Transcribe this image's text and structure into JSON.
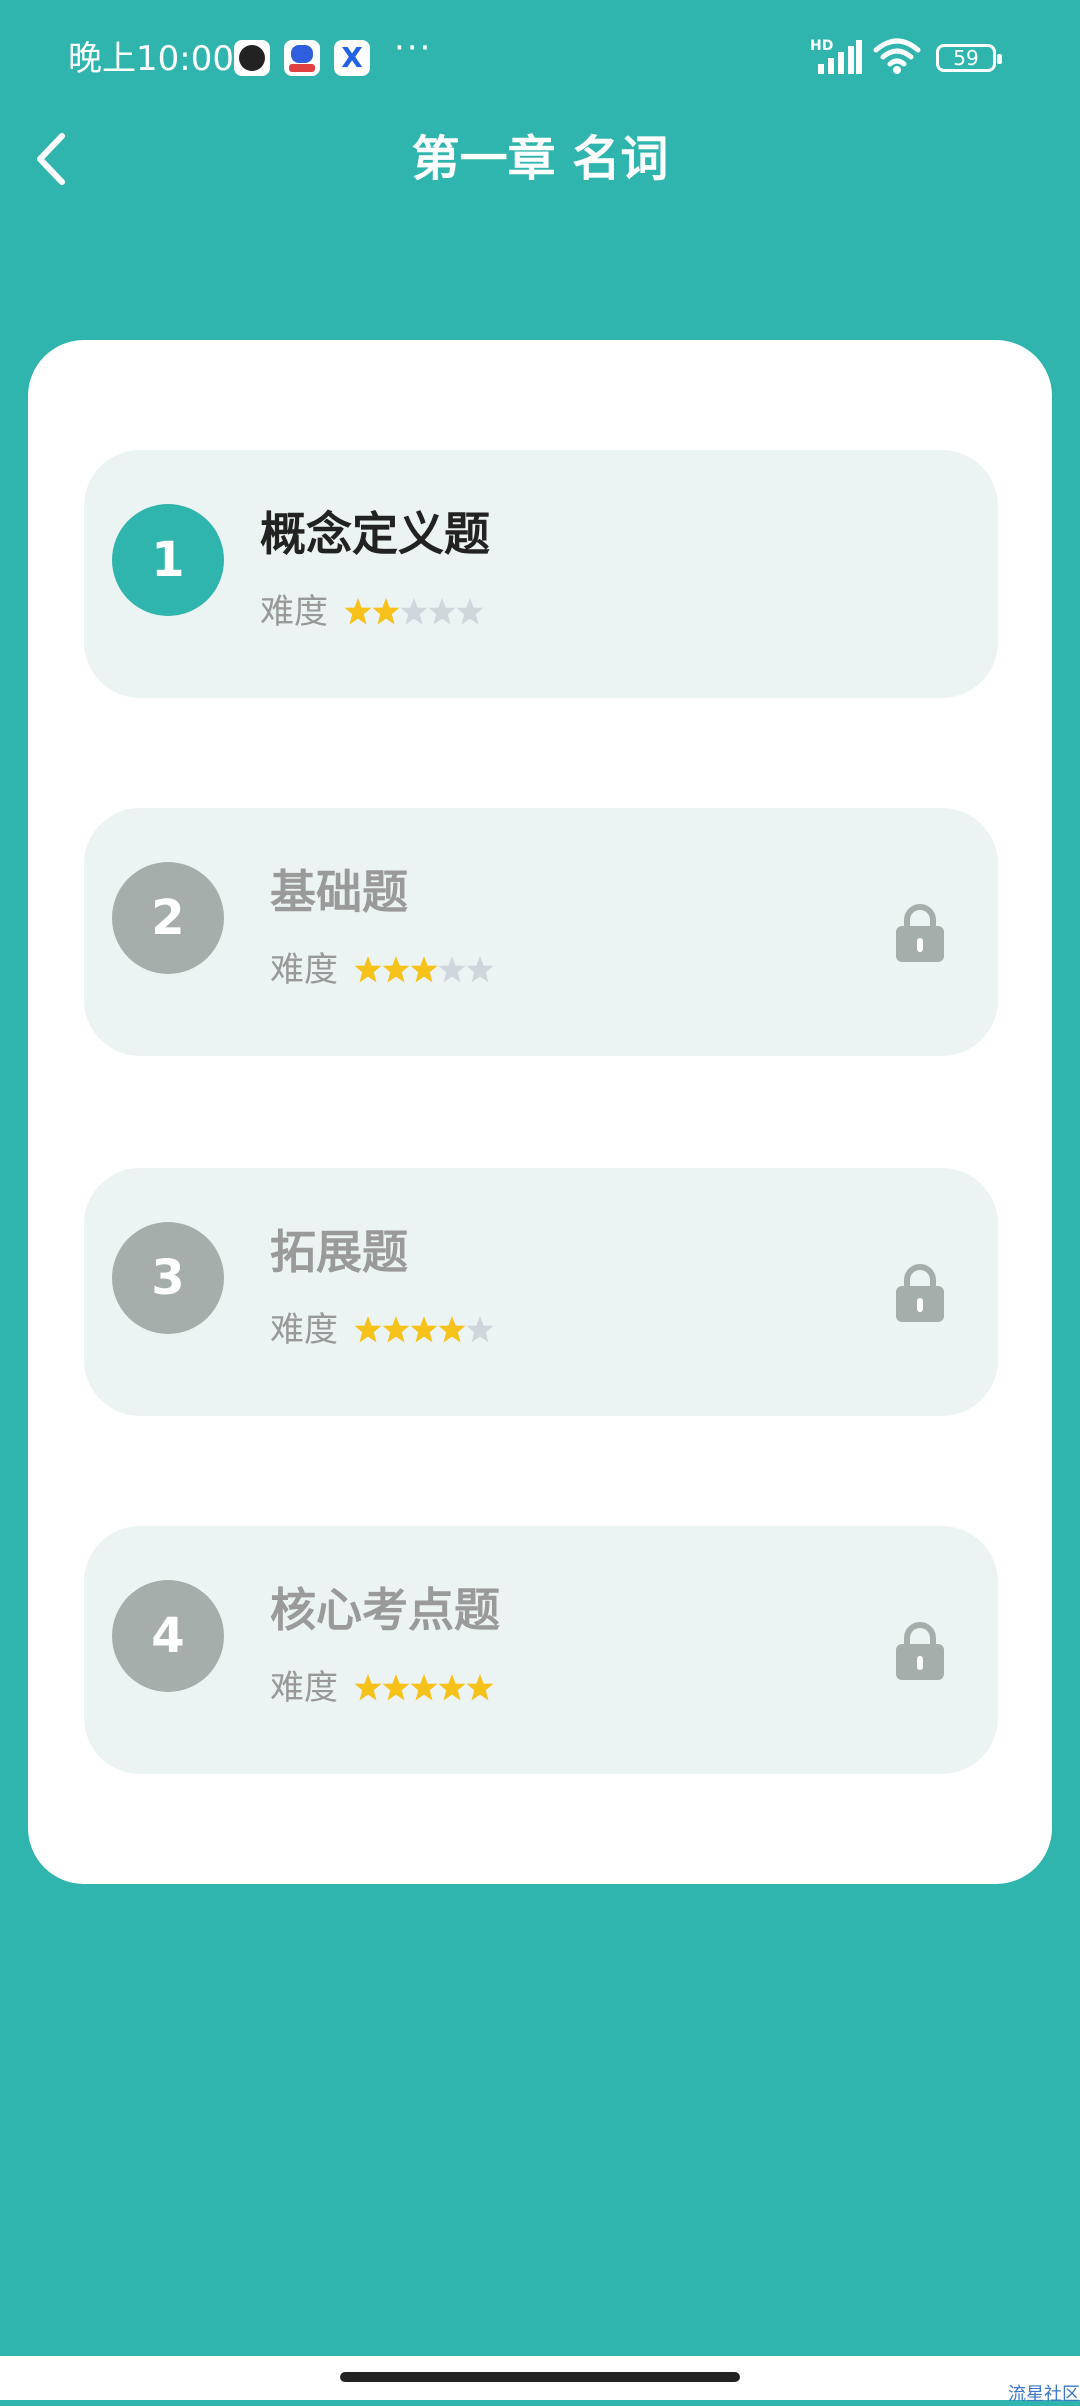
{
  "status_bar": {
    "time": "晚上10:00",
    "app_icon_x": "X",
    "more": "···",
    "network": "HD",
    "battery": "59"
  },
  "header": {
    "back_icon": "chevron-left-icon",
    "title": "第一章 名词"
  },
  "difficulty_label": "难度",
  "levels": [
    {
      "number": "1",
      "title": "概念定义题",
      "stars": 2,
      "max_stars": 5,
      "locked": false
    },
    {
      "number": "2",
      "title": "基础题",
      "stars": 3,
      "max_stars": 5,
      "locked": true
    },
    {
      "number": "3",
      "title": "拓展题",
      "stars": 4,
      "max_stars": 5,
      "locked": true
    },
    {
      "number": "4",
      "title": "核心考点题",
      "stars": 5,
      "max_stars": 5,
      "locked": true
    }
  ],
  "colors": {
    "accent": "#2fb5ad",
    "star_on": "#f6c21a",
    "star_off": "#cfd6dc",
    "locked": "#a6aeab"
  },
  "watermark": "流星社区"
}
